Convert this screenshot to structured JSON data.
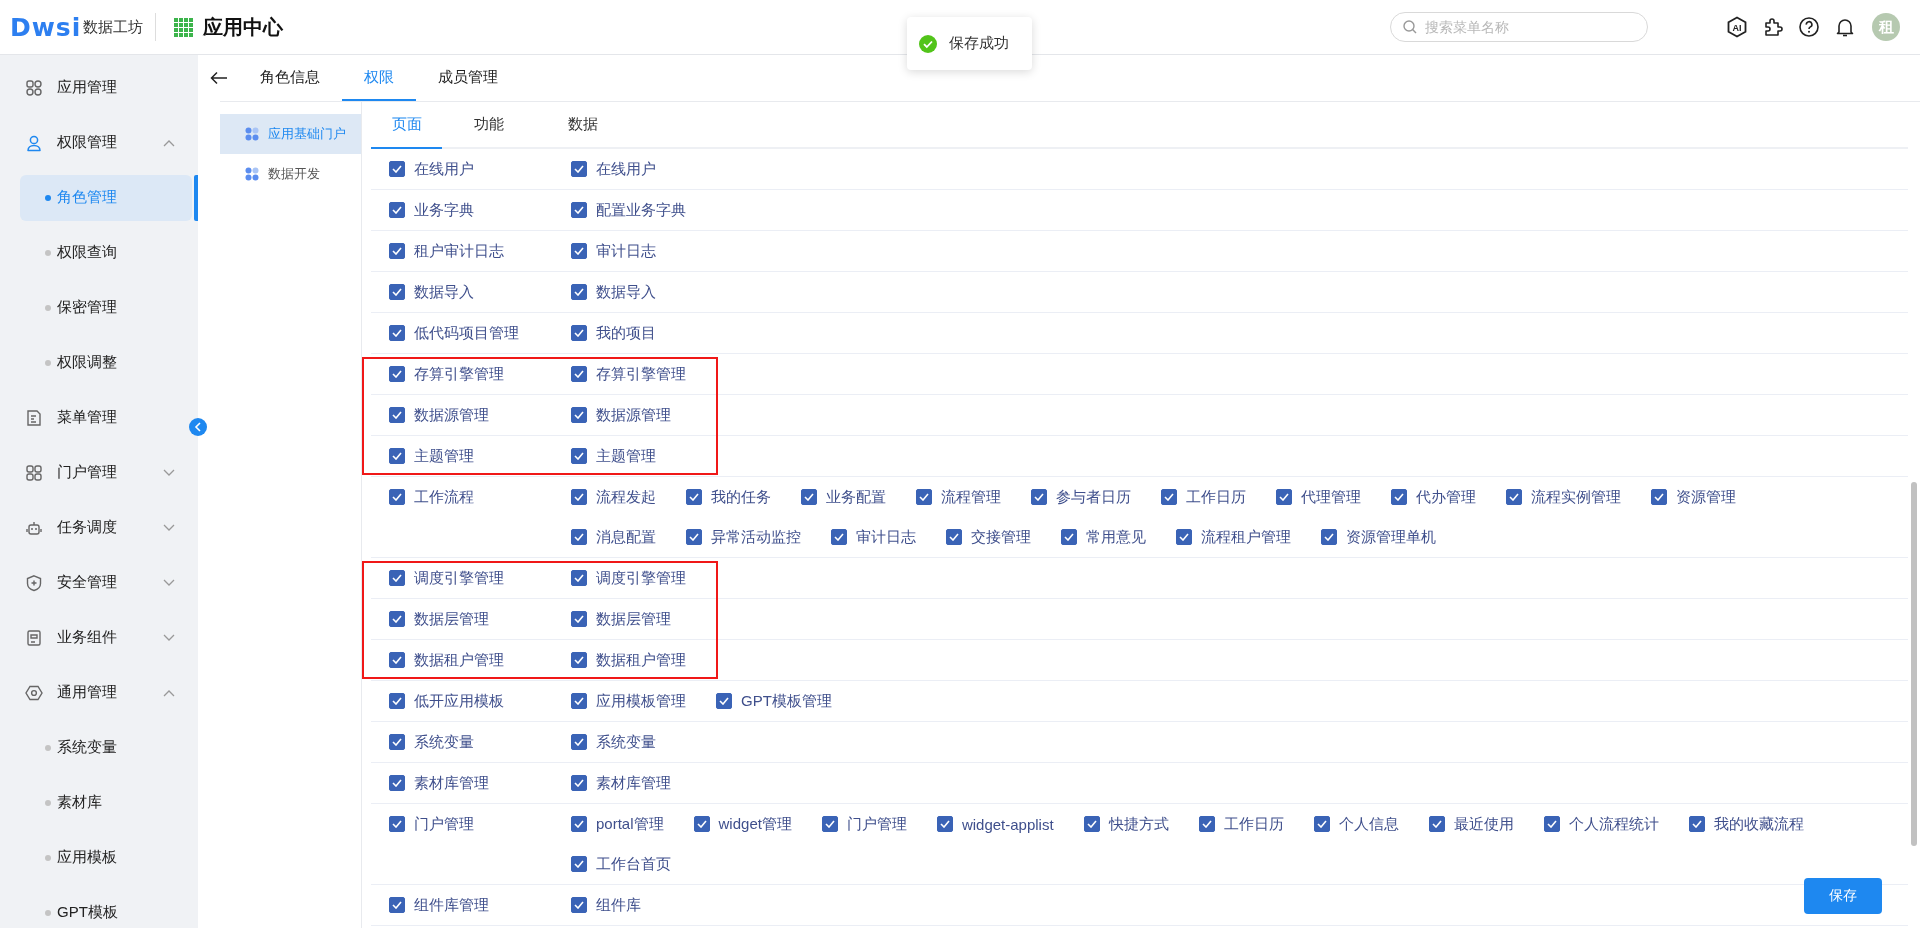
{
  "header": {
    "logo_mark": "Dwsi",
    "logo_name": "数据工坊",
    "app_title": "应用中心",
    "search": {
      "placeholder": "搜索菜单名称"
    },
    "ai_label": "AI",
    "avatar": "租"
  },
  "toast": {
    "kind": "success",
    "text": "保存成功"
  },
  "sidebar": {
    "collapse_button": true,
    "items": [
      {
        "label": "应用管理"
      },
      {
        "label": "权限管理",
        "expanded": true,
        "children": [
          {
            "label": "角色管理",
            "selected": true
          },
          {
            "label": "权限查询",
            "selected": false
          },
          {
            "label": "保密管理",
            "selected": false
          },
          {
            "label": "权限调整",
            "selected": false
          }
        ]
      },
      {
        "label": "菜单管理"
      },
      {
        "label": "门户管理",
        "expanded": false
      },
      {
        "label": "任务调度",
        "expanded": false
      },
      {
        "label": "安全管理",
        "expanded": false
      },
      {
        "label": "业务组件",
        "expanded": false
      },
      {
        "label": "通用管理",
        "expanded": true,
        "children": [
          {
            "label": "系统变量",
            "selected": false
          },
          {
            "label": "素材库",
            "selected": false
          },
          {
            "label": "应用模板",
            "selected": false
          },
          {
            "label": "GPT模板",
            "selected": false
          }
        ]
      }
    ]
  },
  "tabs": [
    {
      "label": "角色信息",
      "selected": false
    },
    {
      "label": "权限",
      "selected": true
    },
    {
      "label": "成员管理",
      "selected": false
    }
  ],
  "apps": [
    {
      "label": "应用基础门户",
      "selected": true
    },
    {
      "label": "数据开发",
      "selected": false
    }
  ],
  "subtabs": [
    {
      "label": "页面",
      "selected": true
    },
    {
      "label": "功能",
      "selected": false
    },
    {
      "label": "数据",
      "selected": false
    }
  ],
  "rows": [
    {
      "label": "在线用户",
      "checked": true,
      "marked": false,
      "lines": [
        [
          {
            "label": "在线用户",
            "checked": true
          }
        ]
      ]
    },
    {
      "label": "业务字典",
      "checked": true,
      "marked": false,
      "lines": [
        [
          {
            "label": "配置业务字典",
            "checked": true
          }
        ]
      ]
    },
    {
      "label": "租户审计日志",
      "checked": true,
      "marked": false,
      "lines": [
        [
          {
            "label": "审计日志",
            "checked": true
          }
        ]
      ]
    },
    {
      "label": "数据导入",
      "checked": true,
      "marked": false,
      "lines": [
        [
          {
            "label": "数据导入",
            "checked": true
          }
        ]
      ]
    },
    {
      "label": "低代码项目管理",
      "checked": true,
      "marked": false,
      "lines": [
        [
          {
            "label": "我的项目",
            "checked": true
          }
        ]
      ]
    },
    {
      "label": "存算引擎管理",
      "checked": true,
      "marked": true,
      "lines": [
        [
          {
            "label": "存算引擎管理",
            "checked": true
          }
        ]
      ]
    },
    {
      "label": "数据源管理",
      "checked": true,
      "marked": true,
      "lines": [
        [
          {
            "label": "数据源管理",
            "checked": true
          }
        ]
      ]
    },
    {
      "label": "主题管理",
      "checked": true,
      "marked": true,
      "lines": [
        [
          {
            "label": "主题管理",
            "checked": true
          }
        ]
      ]
    },
    {
      "label": "工作流程",
      "checked": true,
      "marked": false,
      "lines": [
        [
          {
            "label": "流程发起",
            "checked": true
          },
          {
            "label": "我的任务",
            "checked": true
          },
          {
            "label": "业务配置",
            "checked": true
          },
          {
            "label": "流程管理",
            "checked": true
          },
          {
            "label": "参与者日历",
            "checked": true
          },
          {
            "label": "工作日历",
            "checked": true
          },
          {
            "label": "代理管理",
            "checked": true
          },
          {
            "label": "代办管理",
            "checked": true
          },
          {
            "label": "流程实例管理",
            "checked": true
          },
          {
            "label": "资源管理",
            "checked": true
          }
        ],
        [
          {
            "label": "消息配置",
            "checked": true
          },
          {
            "label": "异常活动监控",
            "checked": true
          },
          {
            "label": "审计日志",
            "checked": true
          },
          {
            "label": "交接管理",
            "checked": true
          },
          {
            "label": "常用意见",
            "checked": true
          },
          {
            "label": "流程租户管理",
            "checked": true
          },
          {
            "label": "资源管理单机",
            "checked": true
          }
        ]
      ]
    },
    {
      "label": "调度引擎管理",
      "checked": true,
      "marked": true,
      "lines": [
        [
          {
            "label": "调度引擎管理",
            "checked": true
          }
        ]
      ]
    },
    {
      "label": "数据层管理",
      "checked": true,
      "marked": true,
      "lines": [
        [
          {
            "label": "数据层管理",
            "checked": true
          }
        ]
      ]
    },
    {
      "label": "数据租户管理",
      "checked": true,
      "marked": true,
      "lines": [
        [
          {
            "label": "数据租户管理",
            "checked": true
          }
        ]
      ]
    },
    {
      "label": "低开应用模板",
      "checked": true,
      "marked": false,
      "lines": [
        [
          {
            "label": "应用模板管理",
            "checked": true
          },
          {
            "label": "GPT模板管理",
            "checked": true
          }
        ]
      ]
    },
    {
      "label": "系统变量",
      "checked": true,
      "marked": false,
      "lines": [
        [
          {
            "label": "系统变量",
            "checked": true
          }
        ]
      ]
    },
    {
      "label": "素材库管理",
      "checked": true,
      "marked": false,
      "lines": [
        [
          {
            "label": "素材库管理",
            "checked": true
          }
        ]
      ]
    },
    {
      "label": "门户管理",
      "checked": true,
      "marked": false,
      "lines": [
        [
          {
            "label": "portal管理",
            "checked": true
          },
          {
            "label": "widget管理",
            "checked": true
          },
          {
            "label": "门户管理",
            "checked": true
          },
          {
            "label": "widget-applist",
            "checked": true
          },
          {
            "label": "快捷方式",
            "checked": true
          },
          {
            "label": "工作日历",
            "checked": true
          },
          {
            "label": "个人信息",
            "checked": true
          },
          {
            "label": "最近使用",
            "checked": true
          },
          {
            "label": "个人流程统计",
            "checked": true
          },
          {
            "label": "我的收藏流程",
            "checked": true
          }
        ],
        [
          {
            "label": "工作台首页",
            "checked": true
          }
        ]
      ]
    },
    {
      "label": "组件库管理",
      "checked": true,
      "marked": false,
      "lines": [
        [
          {
            "label": "组件库",
            "checked": true
          }
        ]
      ]
    }
  ],
  "save_button": "保存"
}
